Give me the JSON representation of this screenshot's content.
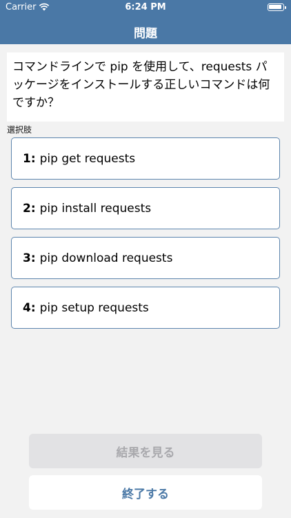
{
  "status_bar": {
    "carrier": "Carrier",
    "time": "6:24 PM"
  },
  "nav": {
    "title": "問題"
  },
  "question": {
    "text": "コマンドラインで pip を使用して、requests パッケージをインストールする正しいコマンドは何ですか？"
  },
  "choices_label": "選択肢",
  "choices": [
    {
      "num": "1:",
      "text": "pip get requests"
    },
    {
      "num": "2:",
      "text": "pip install requests"
    },
    {
      "num": "3:",
      "text": "pip download requests"
    },
    {
      "num": "4:",
      "text": "pip setup requests"
    }
  ],
  "buttons": {
    "show_result": "結果を見る",
    "finish": "終了する"
  },
  "colors": {
    "nav_bar": "#4a78a6",
    "choice_border": "#5b84ad",
    "background": "#f2f2f2",
    "disabled_button": "#e2e2e4"
  }
}
